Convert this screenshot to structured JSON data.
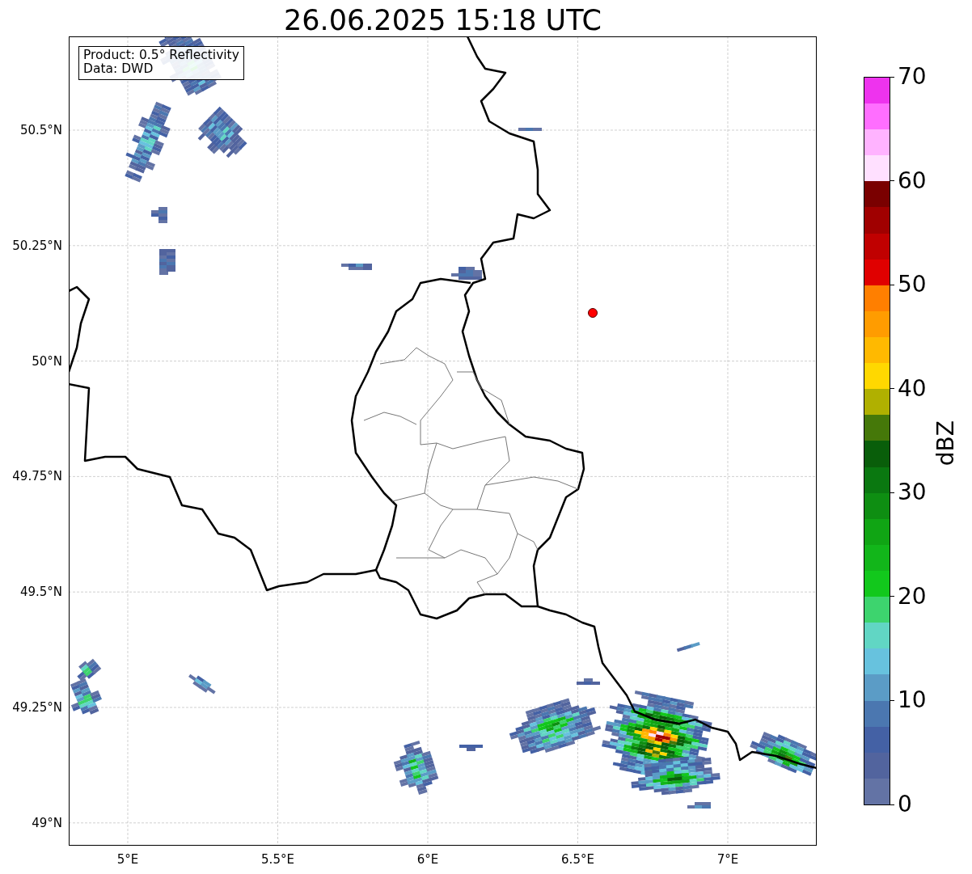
{
  "title": "26.06.2025 15:18 UTC",
  "map": {
    "info_box": [
      "Product: 0.5° Reflectivity",
      "Data: DWD"
    ],
    "latitude_ticks": [
      "50.5°N",
      "50.25°N",
      "50°N",
      "49.75°N",
      "49.5°N",
      "49.25°N",
      "49°N"
    ],
    "longitude_ticks": [
      "5°E",
      "5.5°E",
      "6°E",
      "6.5°E",
      "7°E"
    ]
  },
  "colorbar": {
    "label": "dBZ",
    "ticks": [
      "70",
      "60",
      "50",
      "40",
      "30",
      "20",
      "10",
      "0"
    ],
    "segments": [
      {
        "color": "#6373a5"
      },
      {
        "color": "#52649e"
      },
      {
        "color": "#4461a5"
      },
      {
        "color": "#4b77b0"
      },
      {
        "color": "#5b9cc6"
      },
      {
        "color": "#67c2de"
      },
      {
        "color": "#61d6c4"
      },
      {
        "color": "#3dd46e"
      },
      {
        "color": "#12c81c"
      },
      {
        "color": "#12b61a"
      },
      {
        "color": "#10a514"
      },
      {
        "color": "#0e8e12"
      },
      {
        "color": "#0a7810"
      },
      {
        "color": "#095e0a"
      },
      {
        "color": "#457809"
      },
      {
        "color": "#b0b000"
      },
      {
        "color": "#ffd800"
      },
      {
        "color": "#ffb900"
      },
      {
        "color": "#ff9c00"
      },
      {
        "color": "#ff7f00"
      },
      {
        "color": "#e00000"
      },
      {
        "color": "#c00000"
      },
      {
        "color": "#a00000"
      },
      {
        "color": "#7a0000"
      },
      {
        "color": "#ffe0ff"
      },
      {
        "color": "#ffb3ff"
      },
      {
        "color": "#ff6eff"
      },
      {
        "color": "#ee33ee"
      }
    ]
  }
}
